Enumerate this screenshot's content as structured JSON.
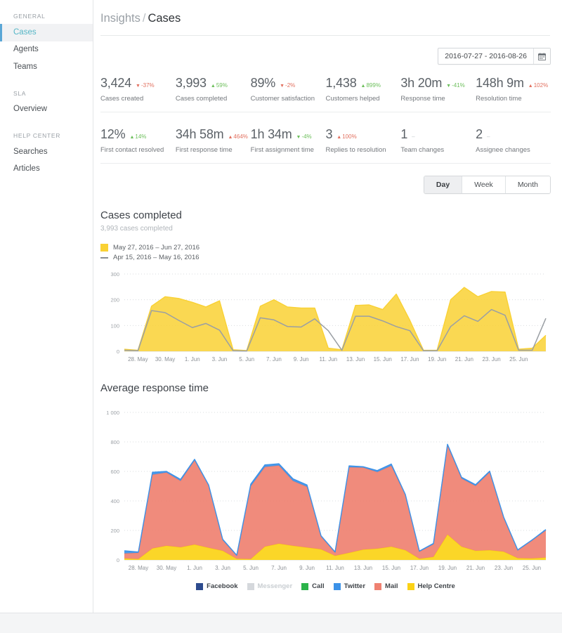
{
  "sidebar": {
    "groups": [
      {
        "title": "GENERAL",
        "items": [
          {
            "label": "Cases",
            "active": true
          },
          {
            "label": "Agents",
            "active": false
          },
          {
            "label": "Teams",
            "active": false
          }
        ]
      },
      {
        "title": "SLA",
        "items": [
          {
            "label": "Overview",
            "active": false
          }
        ]
      },
      {
        "title": "HELP CENTER",
        "items": [
          {
            "label": "Searches",
            "active": false
          },
          {
            "label": "Articles",
            "active": false
          }
        ]
      }
    ]
  },
  "breadcrumb": {
    "parent": "Insights",
    "separator": "/",
    "current": "Cases"
  },
  "datepicker": {
    "value": "2016-07-27 - 2016-08-26",
    "icon": "calendar-icon"
  },
  "metrics": {
    "row1": [
      {
        "value": "3,424",
        "delta": "-37%",
        "dir": "down",
        "tone": "bad",
        "label": "Cases created"
      },
      {
        "value": "3,993",
        "delta": "59%",
        "dir": "up",
        "tone": "good",
        "label": "Cases completed"
      },
      {
        "value": "89%",
        "delta": "-2%",
        "dir": "down",
        "tone": "bad",
        "label": "Customer satisfaction"
      },
      {
        "value": "1,438",
        "delta": "899%",
        "dir": "up",
        "tone": "good",
        "label": "Customers helped"
      },
      {
        "value": "3h 20m",
        "delta": "-41%",
        "dir": "down",
        "tone": "good",
        "label": "Response time"
      },
      {
        "value": "148h 9m",
        "delta": "102%",
        "dir": "up",
        "tone": "bad",
        "label": "Resolution time"
      }
    ],
    "row2": [
      {
        "value": "12%",
        "delta": "14%",
        "dir": "up",
        "tone": "good",
        "label": "First contact resolved"
      },
      {
        "value": "34h 58m",
        "delta": "464%",
        "dir": "up",
        "tone": "bad",
        "label": "First response time"
      },
      {
        "value": "1h 34m",
        "delta": "-4%",
        "dir": "down",
        "tone": "good",
        "label": "First assignment time"
      },
      {
        "value": "3",
        "delta": "100%",
        "dir": "up",
        "tone": "bad",
        "label": "Replies to resolution"
      },
      {
        "value": "1",
        "delta": "–",
        "dir": "flat",
        "tone": "flat",
        "label": "Team changes"
      },
      {
        "value": "2",
        "delta": "–",
        "dir": "flat",
        "tone": "flat",
        "label": "Assignee changes"
      }
    ]
  },
  "period_tabs": [
    {
      "label": "Day",
      "active": true
    },
    {
      "label": "Week",
      "active": false
    },
    {
      "label": "Month",
      "active": false
    }
  ],
  "chart_data": [
    {
      "type": "area",
      "id": "cases-completed",
      "title": "Cases completed",
      "subtitle": "3,993 cases completed",
      "xlabel": "",
      "ylabel": "",
      "ylim": [
        0,
        300
      ],
      "yticks": [
        0,
        100,
        200,
        300
      ],
      "ytick_labels": [
        "0",
        "100",
        "200",
        "300"
      ],
      "grid": true,
      "legend_position": "top",
      "legend": [
        {
          "name": "May 27, 2016 – Jun 27, 2016",
          "marker": "swatch",
          "color": "#f9d134"
        },
        {
          "name": "Apr 15, 2016 – May 16, 2016",
          "marker": "dash",
          "color": "#8a8f94"
        }
      ],
      "x": [
        "27. May",
        "28. May",
        "29. May",
        "30. May",
        "31. May",
        "1. Jun",
        "2. Jun",
        "3. Jun",
        "4. Jun",
        "5. Jun",
        "6. Jun",
        "7. Jun",
        "8. Jun",
        "9. Jun",
        "10. Jun",
        "11. Jun",
        "12. Jun",
        "13. Jun",
        "14. Jun",
        "15. Jun",
        "16. Jun",
        "17. Jun",
        "18. Jun",
        "19. Jun",
        "20. Jun",
        "21. Jun",
        "22. Jun",
        "23. Jun",
        "24. Jun",
        "25. Jun",
        "26. Jun"
      ],
      "xtick_labels": [
        "28. May",
        "30. May",
        "1. Jun",
        "3. Jun",
        "5. Jun",
        "7. Jun",
        "9. Jun",
        "11. Jun",
        "13. Jun",
        "15. Jun",
        "17. Jun",
        "19. Jun",
        "21. Jun",
        "23. Jun",
        "25. Jun"
      ],
      "series": [
        {
          "name": "May 27, 2016 – Jun 27, 2016",
          "color": "#f9d134",
          "style": "area",
          "values": [
            8,
            4,
            175,
            212,
            205,
            190,
            172,
            196,
            6,
            3,
            175,
            200,
            172,
            168,
            168,
            12,
            6,
            178,
            180,
            162,
            222,
            120,
            4,
            4,
            200,
            248,
            212,
            232,
            230,
            8,
            12,
            62
          ]
        },
        {
          "name": "Apr 15, 2016 – May 16, 2016",
          "color": "#9a9fa4",
          "style": "line",
          "values": [
            4,
            2,
            158,
            150,
            120,
            92,
            108,
            82,
            2,
            1,
            130,
            122,
            96,
            94,
            126,
            80,
            4,
            136,
            136,
            118,
            96,
            80,
            2,
            2,
            96,
            138,
            116,
            162,
            140,
            4,
            4,
            128
          ]
        }
      ]
    },
    {
      "type": "area",
      "id": "average-response-time",
      "title": "Average response time",
      "subtitle": "",
      "stacked": true,
      "xlabel": "",
      "ylabel": "",
      "ylim": [
        0,
        1000
      ],
      "yticks": [
        0,
        200,
        400,
        600,
        800,
        1000
      ],
      "ytick_labels": [
        "0",
        "200",
        "400",
        "600",
        "800",
        "1 000"
      ],
      "grid": true,
      "legend_position": "bottom",
      "legend": [
        {
          "name": "Facebook",
          "color": "#2d4b8e",
          "disabled": false
        },
        {
          "name": "Messenger",
          "color": "#d5d8dc",
          "disabled": true
        },
        {
          "name": "Call",
          "color": "#2cb34a",
          "disabled": false
        },
        {
          "name": "Twitter",
          "color": "#3c92e8",
          "disabled": false
        },
        {
          "name": "Mail",
          "color": "#ef8171",
          "disabled": false
        },
        {
          "name": "Help Centre",
          "color": "#fbd216",
          "disabled": false
        }
      ],
      "x": [
        "27. May",
        "28. May",
        "29. May",
        "30. May",
        "31. May",
        "1. Jun",
        "2. Jun",
        "3. Jun",
        "4. Jun",
        "5. Jun",
        "6. Jun",
        "7. Jun",
        "8. Jun",
        "9. Jun",
        "10. Jun",
        "11. Jun",
        "12. Jun",
        "13. Jun",
        "14. Jun",
        "15. Jun",
        "16. Jun",
        "17. Jun",
        "18. Jun",
        "19. Jun",
        "20. Jun",
        "21. Jun",
        "22. Jun",
        "23. Jun",
        "24. Jun",
        "25. Jun",
        "26. Jun"
      ],
      "xtick_labels": [
        "28. May",
        "30. May",
        "1. Jun",
        "3. Jun",
        "5. Jun",
        "7. Jun",
        "9. Jun",
        "11. Jun",
        "13. Jun",
        "15. Jun",
        "17. Jun",
        "19. Jun",
        "21. Jun",
        "23. Jun",
        "25. Jun"
      ],
      "series": [
        {
          "name": "Help Centre",
          "color": "#fbd216",
          "style": "area",
          "values": [
            10,
            6,
            78,
            96,
            86,
            104,
            82,
            62,
            8,
            6,
            90,
            110,
            96,
            84,
            72,
            28,
            48,
            70,
            76,
            90,
            66,
            8,
            20,
            172,
            90,
            62,
            66,
            56,
            12,
            10,
            16
          ]
        },
        {
          "name": "Mail",
          "color": "#ef8171",
          "style": "area",
          "values": [
            34,
            42,
            500,
            496,
            450,
            570,
            420,
            72,
            20,
            494,
            540,
            530,
            440,
            412,
            86,
            22,
            580,
            556,
            520,
            548,
            372,
            48,
            86,
            604,
            462,
            440,
            528,
            228,
            52,
            120,
            184
          ]
        },
        {
          "name": "Twitter",
          "color": "#3c92e8",
          "style": "area",
          "values": [
            18,
            6,
            16,
            8,
            10,
            8,
            6,
            6,
            4,
            14,
            14,
            12,
            14,
            12,
            6,
            4,
            10,
            6,
            10,
            12,
            6,
            4,
            6,
            8,
            8,
            8,
            8,
            6,
            4,
            4,
            6
          ]
        }
      ]
    }
  ]
}
